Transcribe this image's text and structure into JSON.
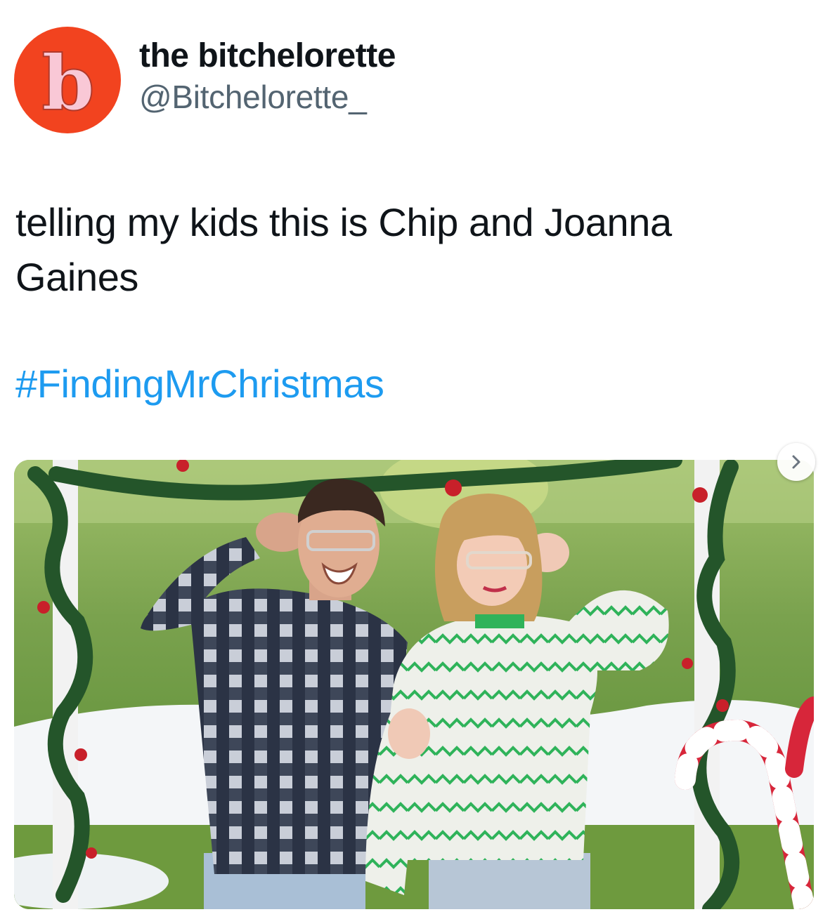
{
  "author": {
    "display_name": "the bitchelorette",
    "handle": "@Bitchelorette_",
    "avatar_letter": "b",
    "avatar_bg": "#f2431f",
    "avatar_letter_color": "#f9c8d6"
  },
  "tweet": {
    "text": "telling my kids this is Chip and Joanna Gaines",
    "hashtag": "#FindingMrChristmas",
    "hashtag_color": "#1d9bf0"
  },
  "media": {
    "icon": "chevron-right-icon"
  }
}
